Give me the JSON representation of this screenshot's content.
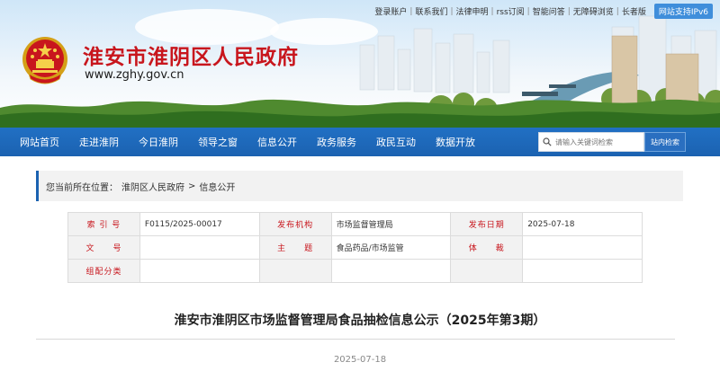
{
  "header": {
    "top_links": [
      "登录账户",
      "联系我们",
      "法律申明",
      "rss订阅",
      "智能问答",
      "无障碍浏览",
      "长者版"
    ],
    "ipv6_badge": "网站支持IPv6",
    "site_title": "淮安市淮阴区人民政府",
    "site_url": "www.zghy.gov.cn",
    "colors": {
      "title": "#c8161d",
      "nav": "#1b62b1"
    }
  },
  "nav": {
    "items": [
      "网站首页",
      "走进淮阴",
      "今日淮阴",
      "领导之窗",
      "信息公开",
      "政务服务",
      "政民互动",
      "数据开放"
    ],
    "search_placeholder": "请输入关键词检索",
    "search_button": "站内检索"
  },
  "breadcrumb": {
    "prefix": "您当前所在位置：",
    "path": [
      "淮阴区人民政府",
      "信息公开"
    ],
    "separator": ">"
  },
  "meta": {
    "rows": [
      [
        {
          "k": "索 引 号"
        },
        {
          "v": "F0115/2025-00017"
        },
        {
          "k": "发布机构"
        },
        {
          "v": "市场监督管理局"
        },
        {
          "k": "发布日期"
        },
        {
          "v": "2025-07-18"
        }
      ],
      [
        {
          "k": "文　　号"
        },
        {
          "v": ""
        },
        {
          "k": "主　　题"
        },
        {
          "v": "食品药品/市场监管"
        },
        {
          "k": "体　　裁"
        },
        {
          "v": ""
        }
      ],
      [
        {
          "k": "组配分类"
        },
        {
          "v": ""
        },
        {
          "k": ""
        },
        {
          "v": ""
        },
        {
          "k": ""
        },
        {
          "v": ""
        }
      ]
    ]
  },
  "article": {
    "title": "淮安市淮阴区市场监督管理局食品抽检信息公示（2025年第3期）",
    "date": "2025-07-18"
  }
}
